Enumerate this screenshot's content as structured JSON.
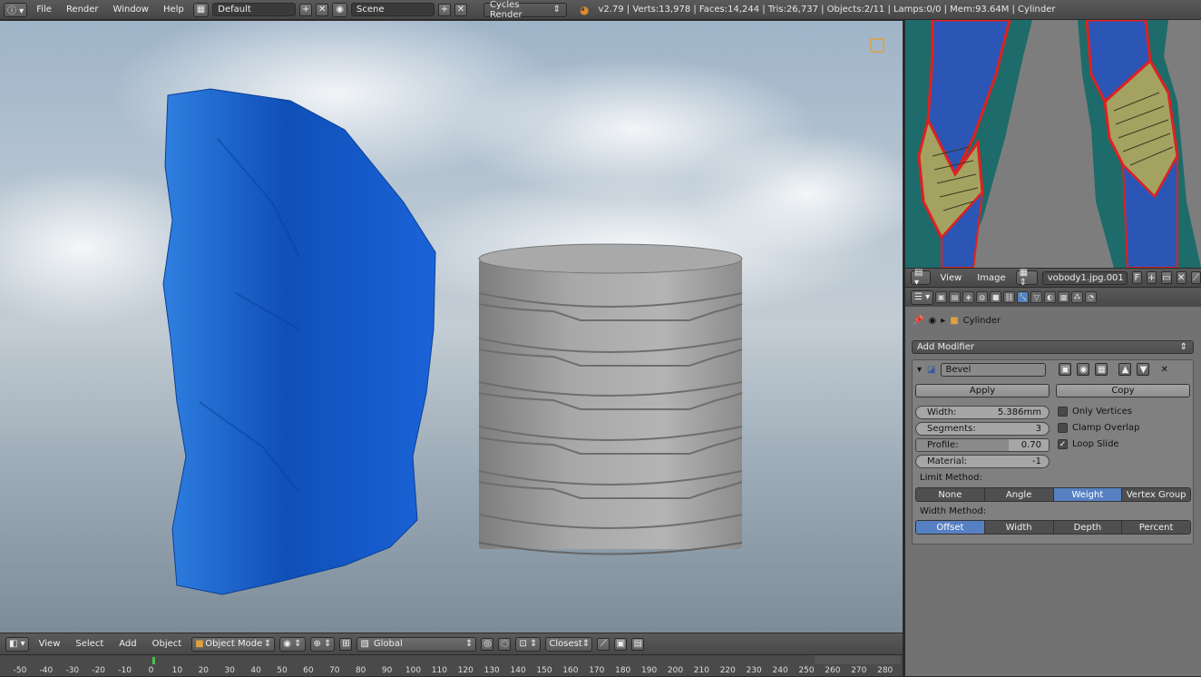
{
  "topbar": {
    "info_icon": "info-icon",
    "menus": [
      "File",
      "Render",
      "Window",
      "Help"
    ],
    "screen_layout": "Default",
    "scene": "Scene",
    "render_engine": "Cycles Render",
    "stats": "v2.79 | Verts:13,978 | Faces:14,244 | Tris:26,737 | Objects:2/11 | Lamps:0/0 | Mem:93.64M | Cylinder"
  },
  "viewport_header": {
    "menus": [
      "View",
      "Select",
      "Add",
      "Object"
    ],
    "mode": "Object Mode",
    "orientation": "Global",
    "snap_target": "Closest"
  },
  "timeline": {
    "ticks": [
      "-50",
      "-40",
      "-30",
      "-20",
      "-10",
      "0",
      "10",
      "20",
      "30",
      "40",
      "50",
      "60",
      "70",
      "80",
      "90",
      "100",
      "110",
      "120",
      "130",
      "140",
      "150",
      "160",
      "170",
      "180",
      "190",
      "200",
      "210",
      "220",
      "230",
      "240",
      "250",
      "260",
      "270",
      "280"
    ]
  },
  "image_editor": {
    "menus": [
      "View",
      "Image"
    ],
    "image_name": "vobody1.jpg.001",
    "fake_user": "F"
  },
  "properties": {
    "object_name": "Cylinder",
    "add_modifier": "Add Modifier",
    "modifier": {
      "name": "Bevel",
      "apply": "Apply",
      "copy": "Copy",
      "width_label": "Width:",
      "width_value": "5.386mm",
      "segments_label": "Segments:",
      "segments_value": "3",
      "profile_label": "Profile:",
      "profile_value": "0.70",
      "profile_fraction": 0.7,
      "material_label": "Material:",
      "material_value": "-1",
      "only_vertices": "Only Vertices",
      "clamp_overlap": "Clamp Overlap",
      "loop_slide": "Loop Slide",
      "limit_method_label": "Limit Method:",
      "limit_methods": [
        "None",
        "Angle",
        "Weight",
        "Vertex Group"
      ],
      "limit_selected": "Weight",
      "width_method_label": "Width Method:",
      "width_methods": [
        "Offset",
        "Width",
        "Depth",
        "Percent"
      ],
      "width_selected": "Offset",
      "only_vertices_checked": false,
      "clamp_overlap_checked": false,
      "loop_slide_checked": true
    }
  },
  "colors": {
    "accent": "#5680c2",
    "cloth": "#1a5fd0",
    "cylinder": "#9a9a9a"
  }
}
